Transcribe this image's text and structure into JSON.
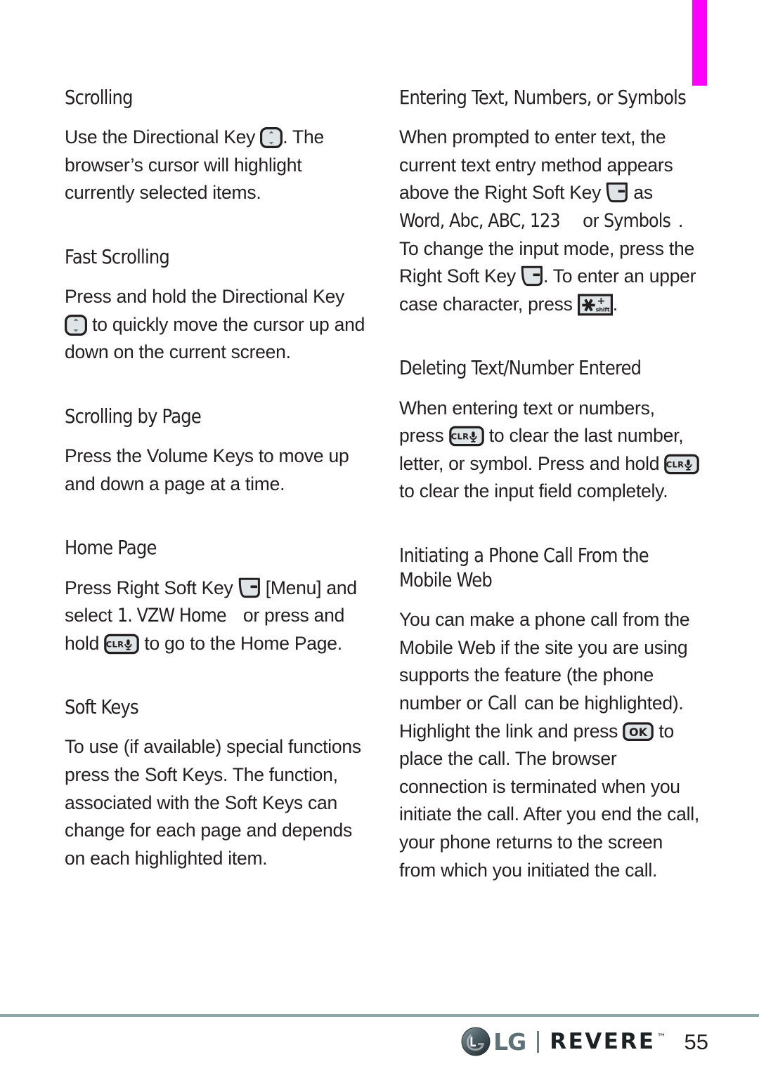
{
  "page": {
    "number": "55",
    "tab_color": "#ff00ff",
    "rule_color": "#8fa7a9",
    "text_color": "#231f20"
  },
  "footer": {
    "brand": "LG",
    "product": "REVERE",
    "trademark": "™",
    "page_number": "55"
  },
  "left_column": {
    "sections": [
      {
        "heading": "Scrolling",
        "paragraphs": [
          {
            "parts": [
              {
                "type": "text",
                "value": "Use the Directional Key "
              },
              {
                "type": "icon",
                "name": "directional-key-icon"
              },
              {
                "type": "text",
                "value": ". The browser’s cursor will highlight currently selected items."
              }
            ]
          }
        ]
      },
      {
        "heading": "Fast Scrolling",
        "paragraphs": [
          {
            "parts": [
              {
                "type": "text",
                "value": "Press and hold the Directional Key "
              },
              {
                "type": "icon",
                "name": "directional-key-icon"
              },
              {
                "type": "text",
                "value": " to quickly move the cursor up and down on the current screen."
              }
            ]
          }
        ]
      },
      {
        "heading": "Scrolling by Page",
        "paragraphs": [
          {
            "parts": [
              {
                "type": "text",
                "value": "Press the Volume Keys to move up and down a page at a time."
              }
            ]
          }
        ]
      },
      {
        "heading": "Home Page",
        "paragraphs": [
          {
            "parts": [
              {
                "type": "text",
                "value": "Press Right Soft Key "
              },
              {
                "type": "icon",
                "name": "right-soft-key-icon"
              },
              {
                "type": "text",
                "value": " [Menu] and select "
              },
              {
                "type": "emph",
                "value": "1. VZW Home"
              },
              {
                "type": "text",
                "value": " or press and hold "
              },
              {
                "type": "icon",
                "name": "clr-key-icon"
              },
              {
                "type": "text",
                "value": " to go to the Home Page."
              }
            ]
          }
        ]
      },
      {
        "heading": "Soft Keys",
        "paragraphs": [
          {
            "parts": [
              {
                "type": "text",
                "value": "To use (if available) special functions press the Soft Keys. The function, associated with the Soft Keys can change for each page and depends on each highlighted item."
              }
            ]
          }
        ]
      }
    ]
  },
  "right_column": {
    "sections": [
      {
        "heading": "Entering Text, Numbers, or Symbols",
        "paragraphs": [
          {
            "parts": [
              {
                "type": "text",
                "value": "When prompted to enter text, the current text entry method appears above the Right Soft Key "
              },
              {
                "type": "icon",
                "name": "right-soft-key-icon"
              },
              {
                "type": "text",
                "value": " as "
              },
              {
                "type": "emph",
                "value": "Word, Abc, ABC, 123"
              },
              {
                "type": "text",
                "value": " or "
              },
              {
                "type": "emph",
                "value": "Symbols"
              },
              {
                "type": "text",
                "value": ". To change the input mode, press the Right Soft Key "
              },
              {
                "type": "icon",
                "name": "right-soft-key-icon"
              },
              {
                "type": "text",
                "value": ". To enter an upper case character, press "
              },
              {
                "type": "icon",
                "name": "shift-star-key-icon"
              },
              {
                "type": "text",
                "value": "."
              }
            ]
          }
        ]
      },
      {
        "heading": "Deleting Text/Number Entered",
        "paragraphs": [
          {
            "parts": [
              {
                "type": "text",
                "value": "When entering text or numbers, press "
              },
              {
                "type": "icon",
                "name": "clr-key-icon"
              },
              {
                "type": "text",
                "value": " to clear the last number, letter, or symbol. Press and hold "
              },
              {
                "type": "icon",
                "name": "clr-key-icon"
              },
              {
                "type": "text",
                "value": " to clear the input field completely."
              }
            ]
          }
        ]
      },
      {
        "heading": "Initiating a Phone Call From the Mobile Web",
        "paragraphs": [
          {
            "parts": [
              {
                "type": "text",
                "value": "You can make a phone call from the Mobile Web if the site you are using supports the feature (the phone number or "
              },
              {
                "type": "emph",
                "value": "Call"
              },
              {
                "type": "text",
                "value": " can be highlighted). Highlight the link and press "
              },
              {
                "type": "icon",
                "name": "ok-key-icon"
              },
              {
                "type": "text",
                "value": " to place the call. The browser connection is terminated when you initiate the call. After you end the call, your phone returns to the screen from which you initiated the call."
              }
            ]
          }
        ]
      }
    ]
  },
  "icons": {
    "directional-key-icon": {
      "label": "Directional Key"
    },
    "right-soft-key-icon": {
      "label": "Right Soft Key"
    },
    "clr-key-icon": {
      "label": "CLR",
      "sub": "CLR"
    },
    "shift-star-key-icon": {
      "label": "shift",
      "sub": "shift",
      "plus": "+"
    },
    "ok-key-icon": {
      "label": "OK",
      "sub": "OK"
    }
  }
}
